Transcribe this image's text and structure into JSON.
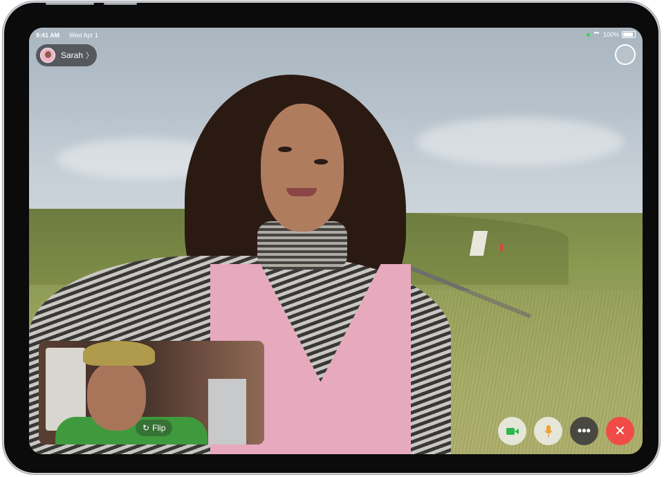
{
  "status_bar": {
    "time": "9:41 AM",
    "date": "Wed Apr 1",
    "battery": "100%",
    "battery_level": 1.0
  },
  "caller": {
    "name": "Sarah",
    "chevron": "〉"
  },
  "self_view": {
    "flip_label": "Flip",
    "flip_icon": "↻"
  },
  "controls": [
    {
      "name": "camera-icon",
      "color": "#2db64d"
    },
    {
      "name": "microphone-icon",
      "color": "#f0a030"
    },
    {
      "name": "more-icon",
      "glyph": "•••"
    },
    {
      "name": "end-call-icon",
      "glyph": "✕",
      "color": "#f04b47"
    }
  ]
}
